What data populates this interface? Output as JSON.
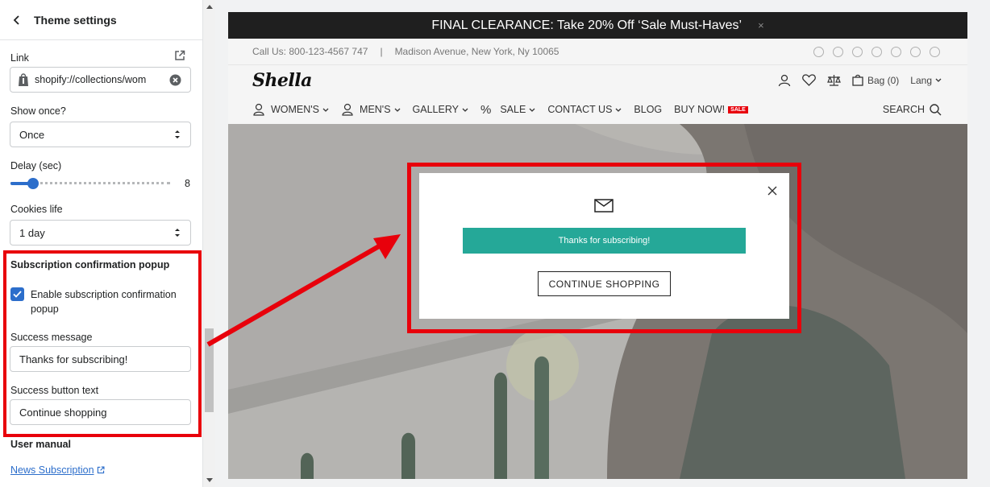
{
  "panel": {
    "title": "Theme settings",
    "link": {
      "label": "Link",
      "value": "shopify://collections/wom"
    },
    "show_once": {
      "label": "Show once?",
      "value": "Once"
    },
    "delay": {
      "label": "Delay (sec)",
      "value": "8",
      "fraction": 0.14
    },
    "cookies": {
      "label": "Cookies life",
      "value": "1 day"
    },
    "subscription": {
      "title": "Subscription confirmation popup",
      "enable_label": "Enable subscription confirmation popup",
      "success_message_label": "Success message",
      "success_message_value": "Thanks for subscribing!",
      "success_button_label": "Success button text",
      "success_button_value": "Continue shopping"
    },
    "manual": {
      "title": "User manual",
      "link": "News Subscription"
    }
  },
  "store": {
    "announcement": "FINAL CLEARANCE: Take 20% Off ‘Sale Must-Haves’",
    "announcement_close": "×",
    "call": "Call Us: 800-123-4567 747",
    "divider": "|",
    "address": "Madison Avenue, New York, Ny 10065",
    "logo": "Shella",
    "bag": "Bag (0)",
    "lang": "Lang",
    "nav": {
      "womens": "WOMEN'S",
      "mens": "MEN'S",
      "gallery": "GALLERY",
      "percent": "%",
      "sale": "SALE",
      "contact": "CONTACT US",
      "blog": "BLOG",
      "buynow": "BUY NOW!",
      "sale_badge": "SALE"
    },
    "search": "SEARCH",
    "popup": {
      "message": "Thanks for subscribing!",
      "button": "CONTINUE SHOPPING"
    }
  },
  "colors": {
    "accent": "#2c6ecb",
    "highlight": "#e8000b",
    "popup_message_bg": "#25a898"
  }
}
